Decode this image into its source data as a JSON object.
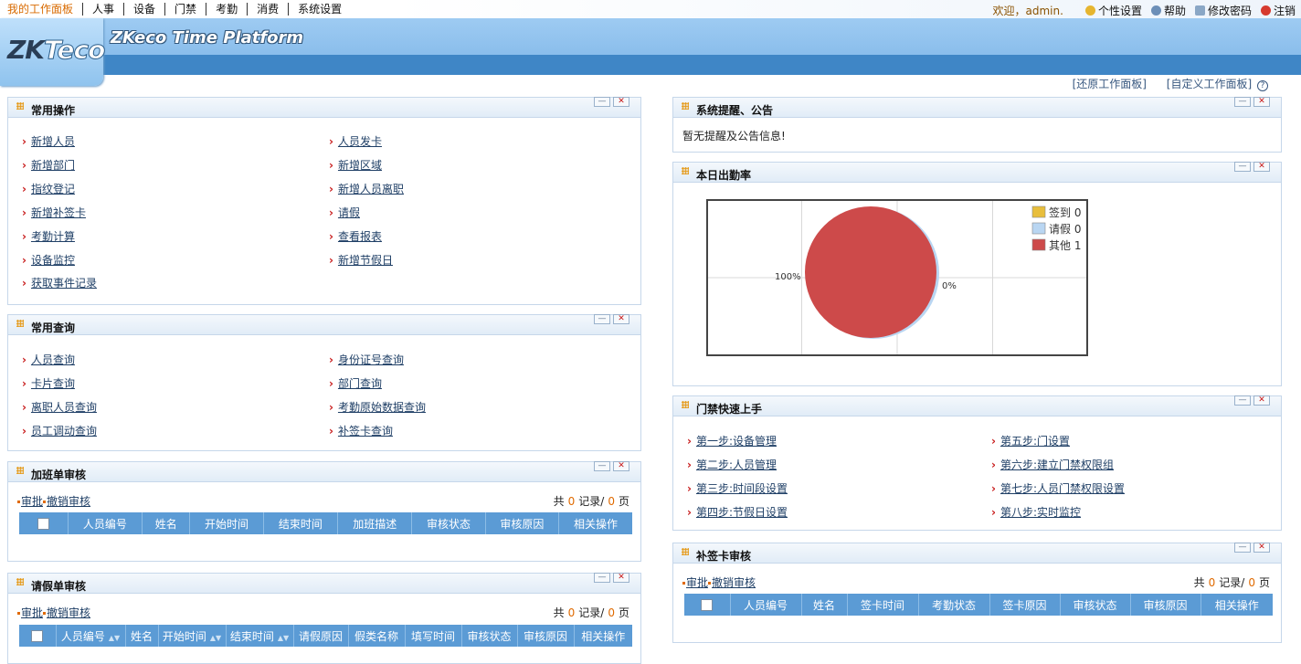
{
  "menu": [
    "我的工作面板",
    "人事",
    "设备",
    "门禁",
    "考勤",
    "消费",
    "系统设置"
  ],
  "user": {
    "welcome": "欢迎，admin.",
    "links": [
      "个性设置",
      "帮助",
      "修改密码",
      "注销"
    ]
  },
  "logo": {
    "zk": "ZK",
    "teco": "Teco"
  },
  "platform_title": "ZKeco Time Platform",
  "toplinks": [
    "[还原工作面板]",
    "[自定义工作面板]"
  ],
  "panels": {
    "common_ops": {
      "title": "常用操作",
      "col1": [
        "新增人员",
        "新增部门",
        "指纹登记",
        "新增补签卡",
        "考勤计算",
        "设备监控",
        "获取事件记录"
      ],
      "col2": [
        "人员发卡",
        "新增区域",
        "新增人员离职",
        "请假",
        "查看报表",
        "新增节假日"
      ]
    },
    "common_query": {
      "title": "常用查询",
      "col1": [
        "人员查询",
        "卡片查询",
        "离职人员查询",
        "员工调动查询"
      ],
      "col2": [
        "身份证号查询",
        "部门查询",
        "考勤原始数据查询",
        "补签卡查询"
      ]
    },
    "overtime": {
      "title": "加班单审核",
      "actions": [
        "审批",
        "撤销审核"
      ],
      "pager": {
        "prefix": "共",
        "records": "0",
        "mid": "记录/",
        "pages": "0",
        "suffix": "页"
      },
      "columns": [
        "人员编号",
        "姓名",
        "开始时间",
        "结束时间",
        "加班描述",
        "审核状态",
        "审核原因",
        "相关操作"
      ]
    },
    "leave": {
      "title": "请假单审核",
      "actions": [
        "审批",
        "撤销审核"
      ],
      "pager": {
        "prefix": "共",
        "records": "0",
        "mid": "记录/",
        "pages": "0",
        "suffix": "页"
      },
      "columns": [
        "人员编号",
        "姓名",
        "开始时间",
        "结束时间",
        "请假原因",
        "假类名称",
        "填写时间",
        "审核状态",
        "审核原因",
        "相关操作"
      ]
    },
    "notice": {
      "title": "系统提醒、公告",
      "text": "暂无提醒及公告信息!"
    },
    "attendance": {
      "title": "本日出勤率"
    },
    "access": {
      "title": "门禁快速上手",
      "col1": [
        "第一步:设备管理",
        "第二步:人员管理",
        "第三步:时间段设置",
        "第四步:节假日设置"
      ],
      "col2": [
        "第五步:门设置",
        "第六步:建立门禁权限组",
        "第七步:人员门禁权限设置",
        "第八步:实时监控"
      ]
    },
    "supplement": {
      "title": "补签卡审核",
      "actions": [
        "审批",
        "撤销审核"
      ],
      "pager": {
        "prefix": "共",
        "records": "0",
        "mid": "记录/",
        "pages": "0",
        "suffix": "页"
      },
      "columns": [
        "人员编号",
        "姓名",
        "签卡时间",
        "考勤状态",
        "签卡原因",
        "审核状态",
        "审核原因",
        "相关操作"
      ]
    }
  },
  "chart_data": {
    "type": "pie",
    "categories": [
      "签到",
      "请假",
      "其他"
    ],
    "values": [
      0,
      0,
      1
    ],
    "colors": [
      "#e8be3c",
      "#b9d6f2",
      "#cd4a4a"
    ],
    "slice_labels": [
      "100%",
      "0%"
    ],
    "legend_position": "top-right",
    "grid": true
  }
}
